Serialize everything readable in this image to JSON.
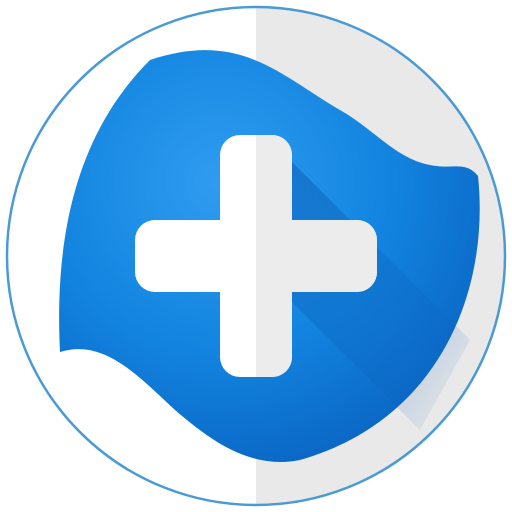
{
  "app_icon": {
    "icon_name": "medical-plus-app-icon",
    "shape": "circle",
    "symbol": "plus",
    "colors": {
      "ring_outline": "#4a9ad6",
      "face_light": "#ffffff",
      "face_shade": "#e9e9e9",
      "blob_light": "#2f9cf0",
      "blob_mid": "#1284df",
      "blob_dark": "#0a63c2",
      "plus_fill": "#ffffff",
      "plus_shade": "#ececec"
    }
  }
}
